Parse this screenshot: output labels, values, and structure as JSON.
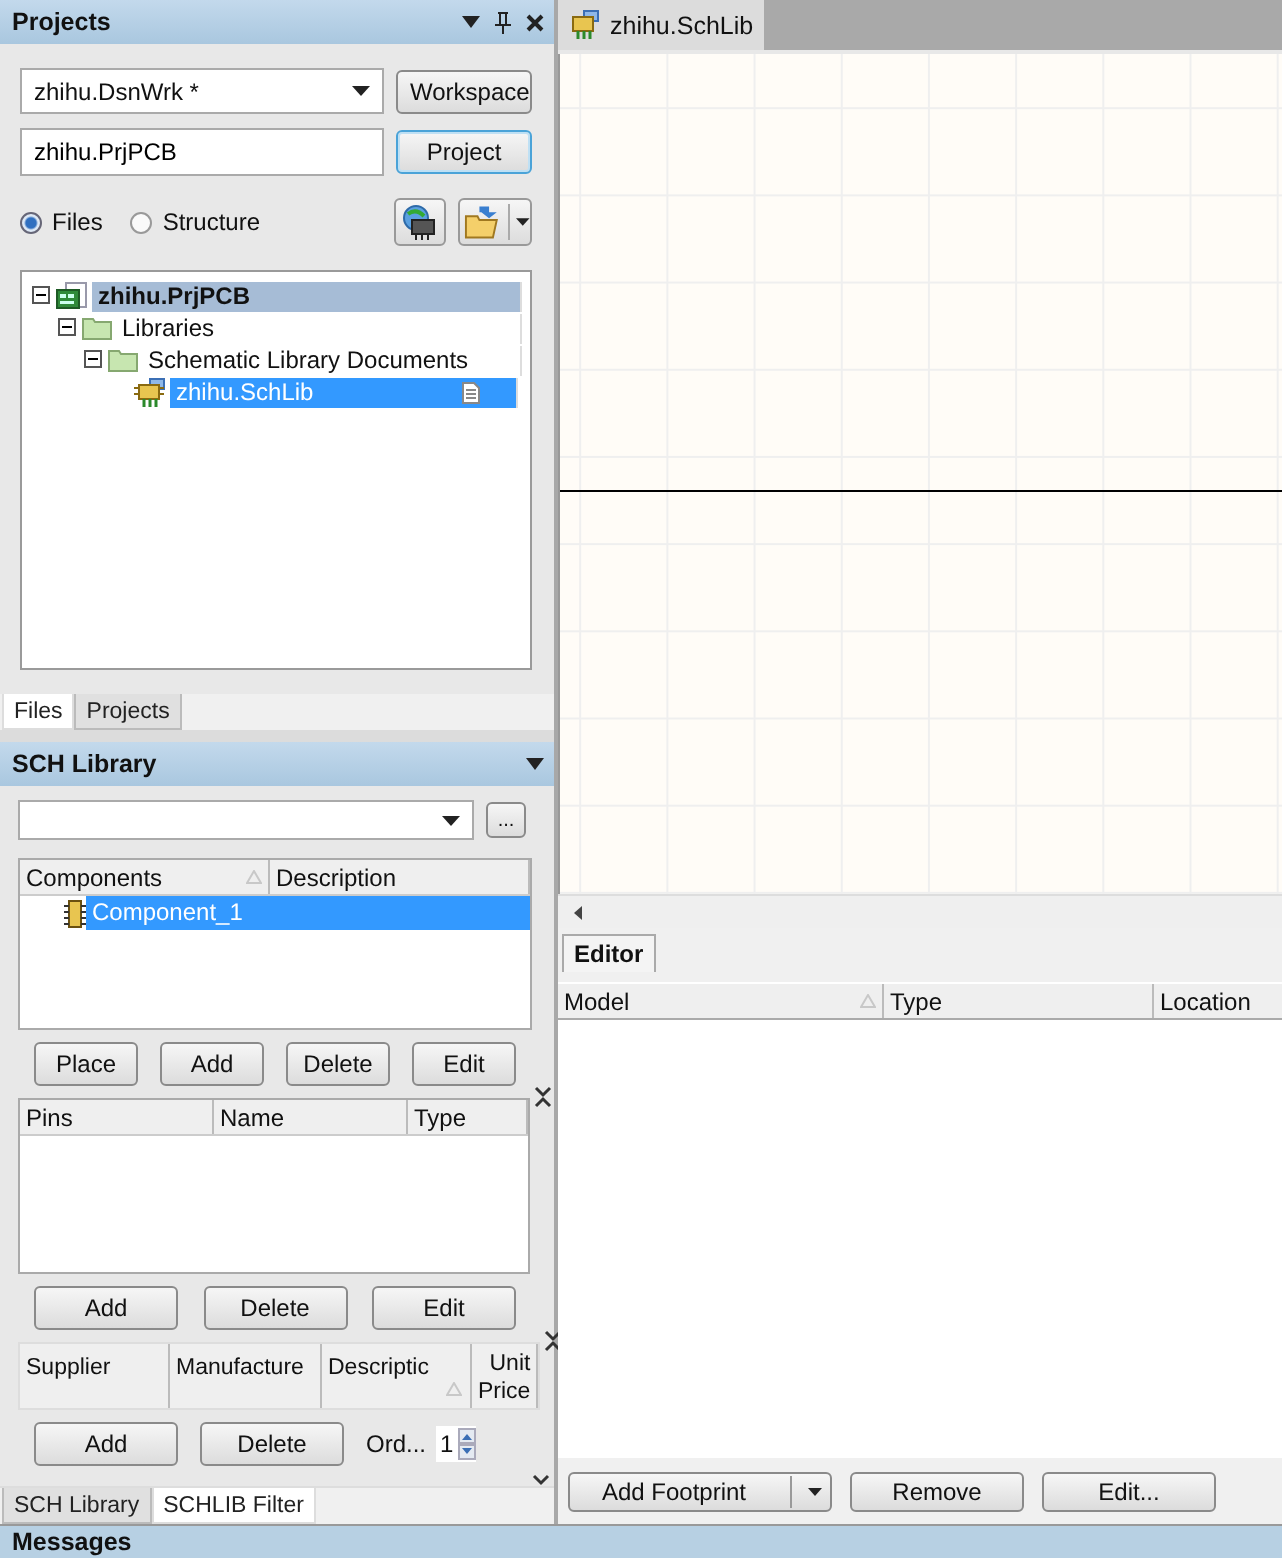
{
  "projects_panel": {
    "title": "Projects",
    "workspace_combo": {
      "value": "zhihu.DsnWrk *"
    },
    "workspace_button": "Workspace",
    "project_field": {
      "value": "zhihu.PrjPCB"
    },
    "project_button": "Project",
    "view_options": [
      {
        "label": "Files",
        "selected": true
      },
      {
        "label": "Structure",
        "selected": false
      }
    ],
    "tree": [
      {
        "label": "zhihu.PrjPCB",
        "kind": "project",
        "expanded": true,
        "selected": false,
        "highlighted": true,
        "children": [
          {
            "label": "Libraries",
            "kind": "folder",
            "expanded": true,
            "selected": false,
            "highlighted": false,
            "children": [
              {
                "label": "Schematic Library Documents",
                "kind": "folder",
                "expanded": true,
                "selected": false,
                "highlighted": false,
                "children": [
                  {
                    "label": "zhihu.SchLib",
                    "kind": "schlib",
                    "selected": true,
                    "highlighted": false
                  }
                ]
              }
            ]
          }
        ]
      }
    ],
    "tabs": [
      {
        "label": "Files",
        "selected": true
      },
      {
        "label": "Projects",
        "selected": false
      }
    ]
  },
  "sch_library_panel": {
    "title": "SCH Library",
    "browse_button": "...",
    "components_table": {
      "columns": [
        {
          "label": "Components",
          "sorted": true
        },
        {
          "label": "Description",
          "sorted": false
        }
      ],
      "rows": [
        {
          "name": "Component_1",
          "selected": true
        }
      ]
    },
    "component_buttons": [
      "Place",
      "Add",
      "Delete",
      "Edit"
    ],
    "pins_table": {
      "columns": [
        {
          "label": "Pins",
          "sorted": false
        },
        {
          "label": "Name",
          "sorted": false
        },
        {
          "label": "Type",
          "sorted": false
        }
      ]
    },
    "pin_buttons": [
      "Add",
      "Delete",
      "Edit"
    ],
    "supplier_table": {
      "columns": [
        {
          "label": "Supplier",
          "sorted": false
        },
        {
          "label": "Manufacture",
          "sorted": false
        },
        {
          "label": "Descriptic",
          "sorted": true
        },
        {
          "label": "Unit Price",
          "sorted": false
        }
      ]
    },
    "supplier_buttons": [
      "Add",
      "Delete"
    ],
    "order_label": "Ord...",
    "order_quantity": {
      "value": "1"
    },
    "tabs": [
      {
        "label": "SCH Library",
        "selected": false
      },
      {
        "label": "SCHLIB Filter",
        "selected": true
      }
    ]
  },
  "document_tabs": [
    {
      "label": "zhihu.SchLib",
      "selected": true
    }
  ],
  "editor_panel": {
    "tabs": [
      {
        "label": "Editor",
        "selected": true
      }
    ],
    "columns": [
      {
        "label": "Model",
        "sorted": true
      },
      {
        "label": "Type",
        "sorted": false
      },
      {
        "label": "Location",
        "sorted": false
      }
    ],
    "buttons": [
      {
        "label": "Add Footprint",
        "kind": "split"
      },
      {
        "label": "Remove",
        "kind": "plain"
      },
      {
        "label": "Edit...",
        "kind": "plain"
      }
    ]
  },
  "messages_panel": {
    "title": "Messages"
  }
}
